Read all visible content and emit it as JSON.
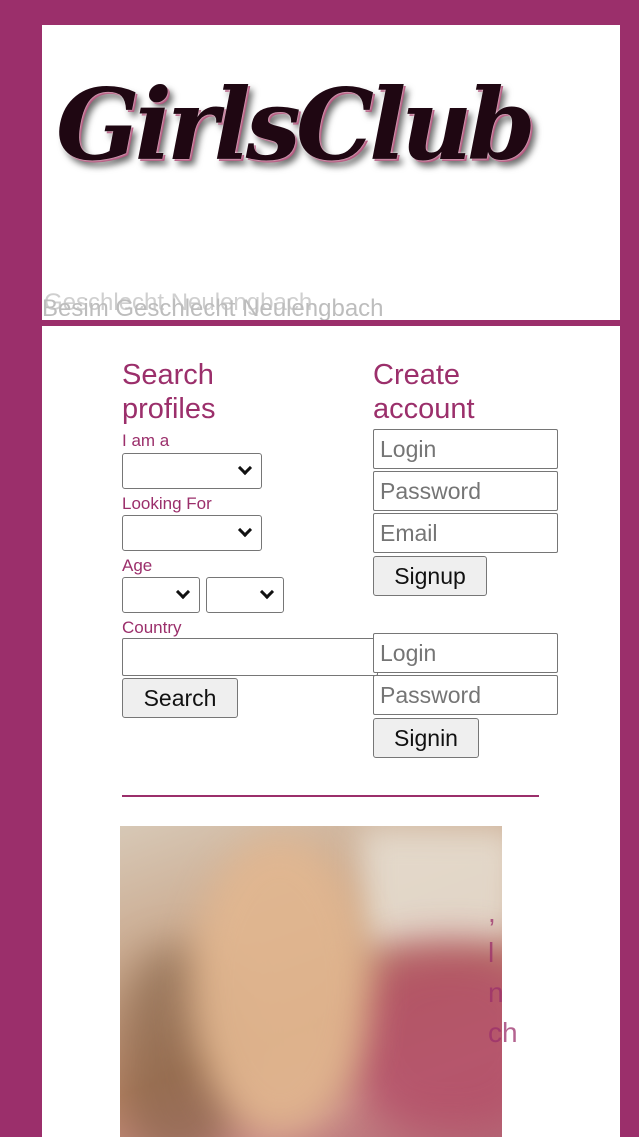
{
  "header": {
    "logo": "GirlsClub",
    "tagline_back": "Geschlecht Neulengbach",
    "tagline_front": "Besim Geschlecht Neulengbach"
  },
  "search": {
    "title": "Search profiles",
    "i_am_a_label": "I am a",
    "looking_for_label": "Looking For",
    "age_label": "Age",
    "country_label": "Country",
    "search_button": "Search"
  },
  "signup": {
    "title": "Create account",
    "login_placeholder": "Login",
    "password_placeholder": "Password",
    "email_placeholder": "Email",
    "signup_button": "Signup"
  },
  "signin": {
    "login_placeholder": "Login",
    "password_placeholder": "Password",
    "signin_button": "Signin"
  },
  "profile": {
    "side_text_lines": [
      ",",
      "",
      "l",
      "n",
      "ch"
    ]
  }
}
